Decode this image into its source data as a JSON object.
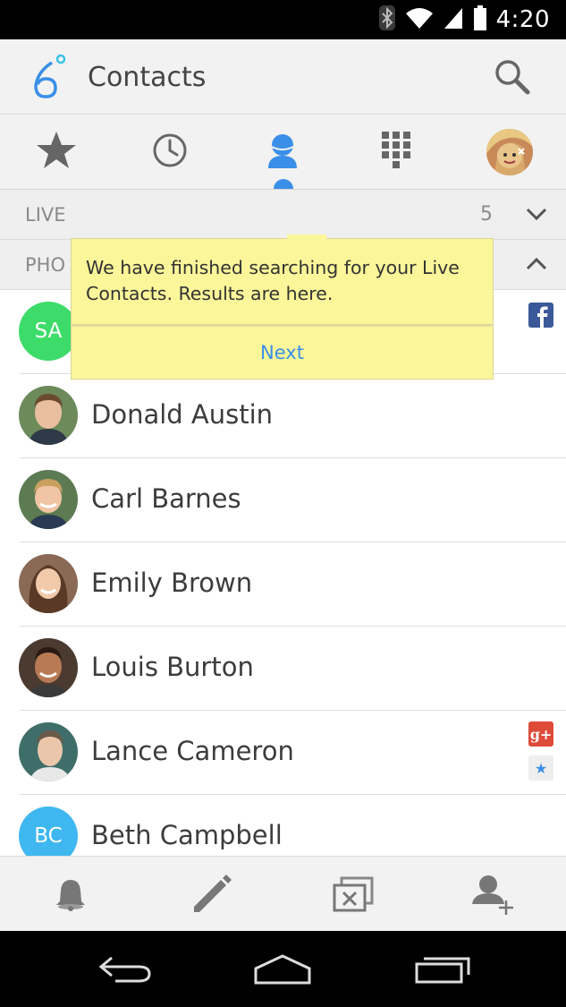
{
  "status_bar": {
    "time": "4:20",
    "icons": [
      "bluetooth-icon",
      "wifi-icon",
      "signal-icon",
      "battery-icon"
    ]
  },
  "app_bar": {
    "logo": "6°",
    "title": "Contacts",
    "search_icon": "search-icon"
  },
  "tabs": [
    {
      "id": "favorites",
      "icon": "star-icon"
    },
    {
      "id": "recent",
      "icon": "clock-icon"
    },
    {
      "id": "contacts",
      "icon": "person-icon",
      "selected": true
    },
    {
      "id": "dialpad",
      "icon": "dialpad-icon"
    },
    {
      "id": "profile",
      "icon": "profile-avatar"
    }
  ],
  "sections": {
    "live": {
      "label": "LIVE",
      "count": "5",
      "chevron": "chevron-down-icon"
    },
    "phone": {
      "label": "PHO",
      "chevron": "chevron-up-icon"
    }
  },
  "tooltip": {
    "message": "We have finished searching for your Live Contacts. Results are here.",
    "button": "Next"
  },
  "contacts": [
    {
      "initials": "SA",
      "name": "",
      "avatar_color": "#3ddc6a",
      "badges": [
        "facebook"
      ]
    },
    {
      "initials": "",
      "name": "Donald Austin",
      "avatar_color": "#6d8a5a",
      "badges": []
    },
    {
      "initials": "",
      "name": "Carl Barnes",
      "avatar_color": "#5d7b52",
      "badges": []
    },
    {
      "initials": "",
      "name": "Emily Brown",
      "avatar_color": "#8a6a55",
      "badges": []
    },
    {
      "initials": "",
      "name": "Louis Burton",
      "avatar_color": "#4a3a30",
      "badges": []
    },
    {
      "initials": "",
      "name": "Lance Cameron",
      "avatar_color": "#3f6e6a",
      "badges": [
        "google-plus",
        "favorite-star"
      ]
    },
    {
      "initials": "BC",
      "name": "Beth Campbell",
      "avatar_color": "#3fb7f0",
      "badges": []
    }
  ],
  "badges": {
    "facebook": {
      "glyph": "f",
      "color": "#3b5998"
    },
    "google_plus": {
      "glyph": "g+",
      "color": "#dd4b39"
    },
    "favorite_star": {
      "glyph": "★",
      "color": "#3a8fe8"
    }
  },
  "bottom_toolbar": [
    "bell-icon",
    "pencil-icon",
    "close-box-icon",
    "add-person-icon"
  ],
  "nav_bar": [
    "back-icon",
    "home-icon",
    "recents-icon"
  ],
  "colors": {
    "accent": "#3a8fe8",
    "tooltip_bg": "#fbf699",
    "bar_bg": "#f2f2f2"
  }
}
